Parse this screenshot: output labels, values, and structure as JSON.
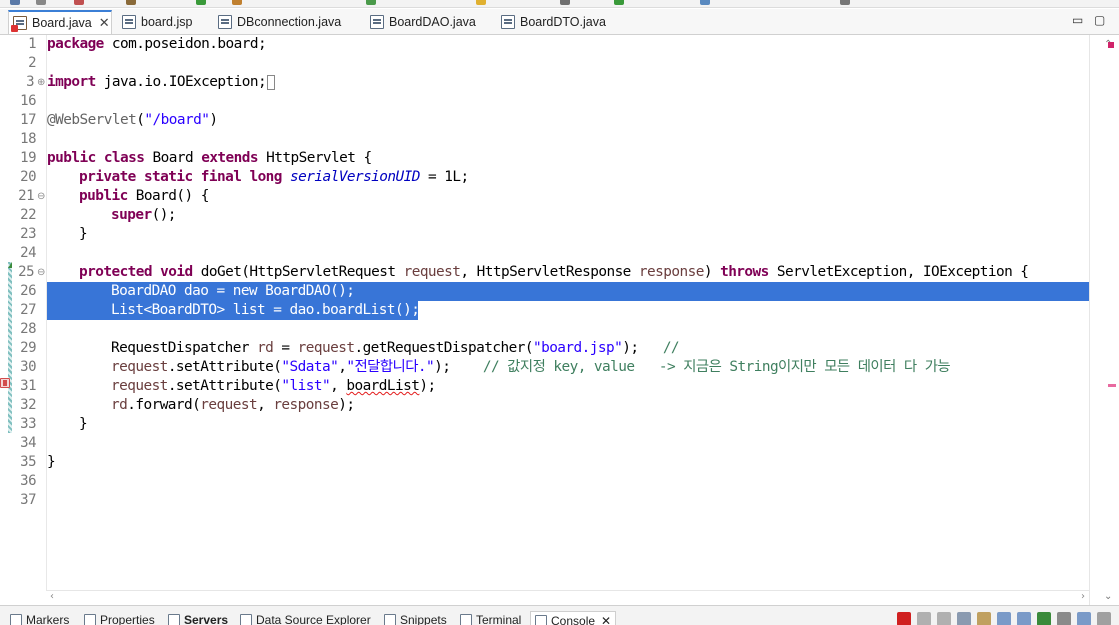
{
  "tabs": [
    {
      "label": "Board.java",
      "active": true,
      "error": true
    },
    {
      "label": "board.jsp",
      "active": false,
      "error": false
    },
    {
      "label": "DBconnection.java",
      "active": false,
      "error": false
    },
    {
      "label": "BoardDAO.java",
      "active": false,
      "error": false
    },
    {
      "label": "BoardDTO.java",
      "active": false,
      "error": false
    }
  ],
  "window_controls": {
    "minimize": "▭",
    "maximize": "▢"
  },
  "gutter": {
    "line_numbers": [
      "1",
      "2",
      "3",
      "16",
      "17",
      "18",
      "19",
      "20",
      "21",
      "22",
      "23",
      "24",
      "25",
      "26",
      "27",
      "28",
      "29",
      "30",
      "31",
      "32",
      "33",
      "34",
      "35",
      "36",
      "37"
    ]
  },
  "code": {
    "l1": {
      "kw": "package",
      "rest": " com.poseidon.board;"
    },
    "l3": {
      "kw": "import",
      "rest": " java.io.IOException;"
    },
    "l17": {
      "ann": "@WebServlet",
      "open": "(",
      "str": "\"/board\"",
      "close": ")"
    },
    "l19": {
      "kw1": "public",
      "kw2": "class",
      "name": " Board ",
      "kw3": "extends",
      "rest": " HttpServlet {"
    },
    "l20": {
      "kw1": "private",
      "kw2": "static",
      "kw3": "final",
      "kw4": "long",
      "field": "serialVersionUID",
      "rest": " = 1L;"
    },
    "l21": {
      "kw": "public",
      "rest": " Board() {"
    },
    "l22": {
      "kw": "super",
      "rest": "();"
    },
    "l23": {
      "text": "}"
    },
    "l25": {
      "kw1": "protected",
      "kw2": "void",
      "sig1": " doGet(HttpServletRequest ",
      "p1": "request",
      "sig2": ", HttpServletResponse ",
      "p2": "response",
      "sig3": ") ",
      "kw3": "throws",
      "rest": " ServletException, IOException {"
    },
    "l26": {
      "text": "BoardDAO dao = new BoardDAO();"
    },
    "l27": {
      "text": "List<BoardDTO> list = dao.boardList();"
    },
    "l29": {
      "a": "RequestDispatcher ",
      "v1": "rd",
      "b": " = ",
      "v2": "request",
      "c": ".getRequestDispatcher(",
      "str": "\"board.jsp\"",
      "d": ");   ",
      "cmt": "//"
    },
    "l30": {
      "v": "request",
      "a": ".setAttribute(",
      "s1": "\"Sdata\"",
      "b": ",",
      "s2": "\"전달합니다.\"",
      "c": ");    ",
      "cmt": "// 값지정 key, value   -> 지금은 String이지만 모든 데이터 다 가능"
    },
    "l31": {
      "v": "request",
      "a": ".setAttribute(",
      "s1": "\"list\"",
      "b": ", ",
      "errv": "boardList",
      "c": ");"
    },
    "l32": {
      "v1": "rd",
      "a": ".forward(",
      "v2": "request",
      "b": ", ",
      "v3": "response",
      "c": ");"
    },
    "l33": {
      "text": "}"
    },
    "l35": {
      "text": "}"
    }
  },
  "bottom_views": [
    {
      "label": "Markers"
    },
    {
      "label": "Properties"
    },
    {
      "label": "Servers",
      "bold": true
    },
    {
      "label": "Data Source Explorer"
    },
    {
      "label": "Snippets"
    },
    {
      "label": "Terminal"
    },
    {
      "label": "Console",
      "active": true
    }
  ],
  "colors": {
    "selection": "#3875d7",
    "keyword": "#7f0055",
    "string": "#2a00ff",
    "comment": "#3f7f5f",
    "field": "#0000c0",
    "annotation": "#646464",
    "variable": "#6a3e3e"
  }
}
